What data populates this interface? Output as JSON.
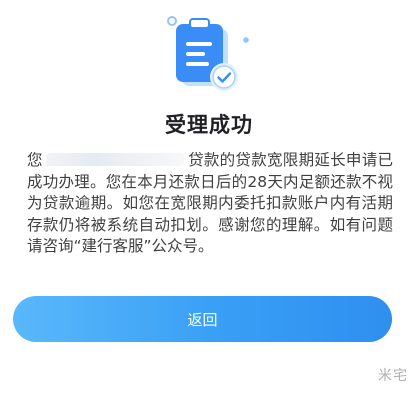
{
  "result": {
    "title": "受理成功",
    "message_prefix": "您",
    "message_rest": "贷款的贷款宽限期延长申请已成功办理。您在本月还款日后的28天内足额还款不视为贷款逾期。如您在宽限期内委托扣款账户内有活期存款仍将被系统自动扣划。感谢您的理解。如有问题请咨询“建行客服”公众号。"
  },
  "actions": {
    "back_label": "返回"
  },
  "watermark": "米宅",
  "icons": {
    "hero": "clipboard-check-icon"
  },
  "colors": {
    "accent": "#3a9ff5",
    "icon_blue": "#2f7ff5",
    "title_text": "#1f1f24",
    "body_text": "#404040"
  }
}
